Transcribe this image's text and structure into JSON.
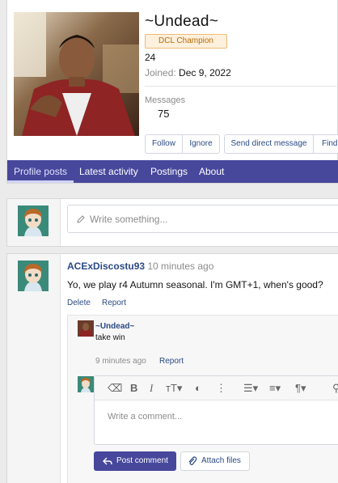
{
  "profile": {
    "username": "~Undead~",
    "badge": "DCL Champion",
    "age": "24",
    "joined_label": "Joined:",
    "joined_date": "Dec 9, 2022",
    "messages_label": "Messages",
    "messages_count": "75",
    "buttons": {
      "follow": "Follow",
      "ignore": "Ignore",
      "send_message": "Send direct message",
      "find": "Find"
    }
  },
  "tabs": [
    {
      "label": "Profile posts",
      "active": true
    },
    {
      "label": "Latest activity"
    },
    {
      "label": "Postings"
    },
    {
      "label": "About"
    }
  ],
  "composer": {
    "placeholder": "Write something..."
  },
  "post": {
    "author": "ACExDiscostu93",
    "separator": "·",
    "time": "10 minutes ago",
    "message": "Yo, we play r4 Autumn seasonal. I'm GMT+1, when's good?",
    "actions": {
      "delete": "Delete",
      "report": "Report"
    },
    "comment": {
      "author": "~Undead~",
      "text": "take win",
      "time": "9 minutes ago",
      "report": "Report"
    },
    "reply": {
      "placeholder": "Write a comment...",
      "post_button": "Post comment",
      "attach_button": "Attach files"
    }
  },
  "colors": {
    "accent": "#47479c",
    "link": "#2b4a85",
    "badge_border": "#f0b97a",
    "badge_text": "#b86a0a"
  }
}
